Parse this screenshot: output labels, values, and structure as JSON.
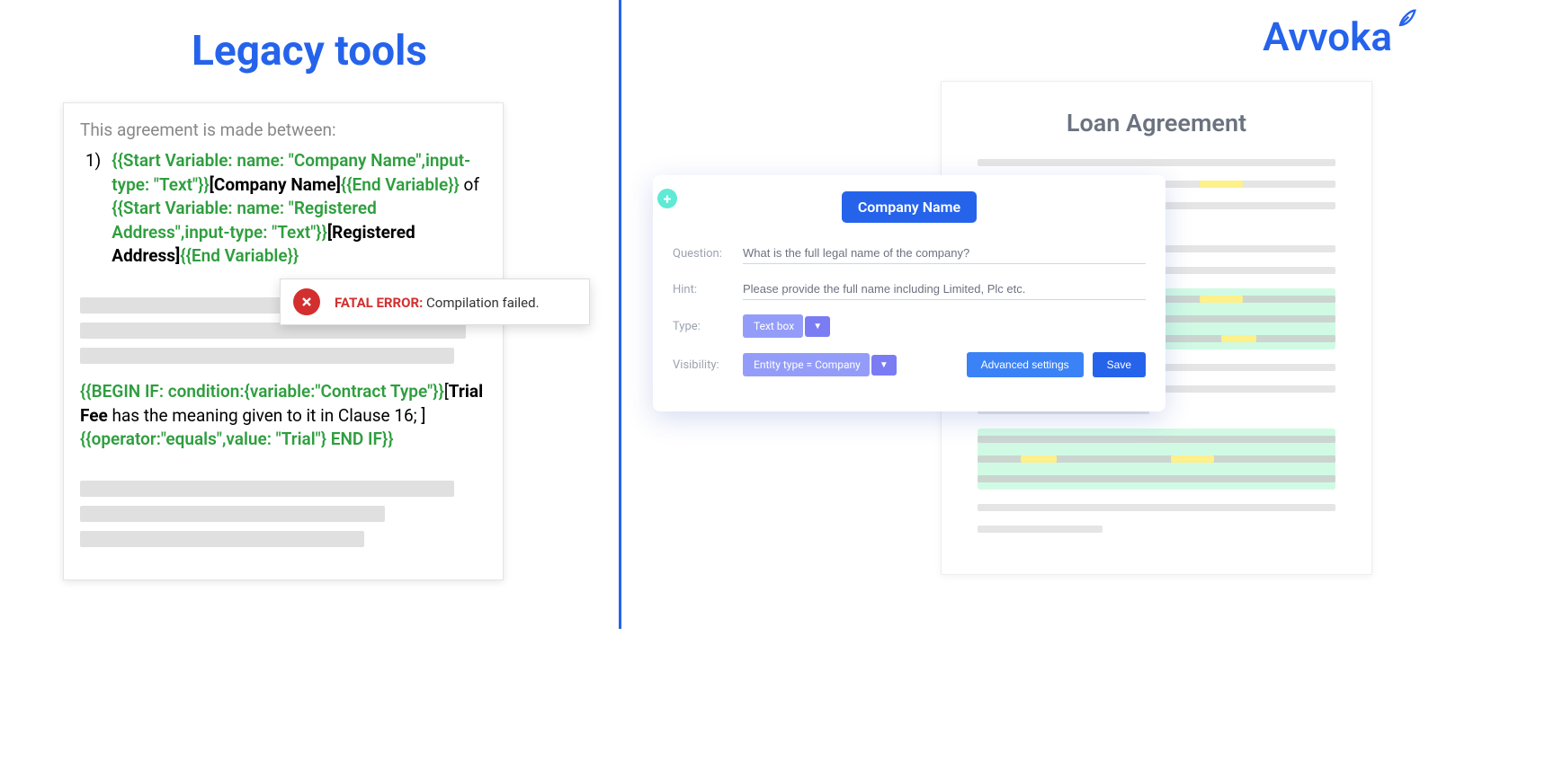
{
  "left": {
    "title": "Legacy tools",
    "doc": {
      "intro": "This agreement is made between:",
      "list_num": "1)",
      "line1_a": "{{Start Variable: name: \"Company Name\",input-type: \"Text\"}}",
      "line1_b": "[Company Name]",
      "line1_c": "{{End Variable}}",
      "line1_of": " of ",
      "line1_d": "{{Start Variable: name: \"Registered Address\",input-type: \"Text\"}}",
      "line1_e": "[Registered Address]",
      "line1_f": "{{End Variable}}",
      "line2_a": "{{BEGIN IF: condition:{variable:\"Contract Type\"}}",
      "line2_b": "[",
      "line2_c": "Trial Fee",
      "line2_d": " has the meaning given to it in Clause 16; ]",
      "line2_e": "{{operator:\"equals\",value: \"Trial\"} END IF}}"
    },
    "error": {
      "label": "FATAL ERROR:",
      "msg": " Compilation failed."
    }
  },
  "right": {
    "brand": "Avvoka",
    "doc_title": "Loan Agreement",
    "form": {
      "badge": "Company Name",
      "question_label": "Question:",
      "question_value": "What is the full legal name of the company?",
      "hint_label": "Hint:",
      "hint_value": "Please provide the full name including Limited, Plc etc.",
      "type_label": "Type:",
      "type_value": "Text box",
      "visibility_label": "Visibility:",
      "visibility_value": "Entity type = Company",
      "advanced": "Advanced settings",
      "save": "Save"
    }
  }
}
